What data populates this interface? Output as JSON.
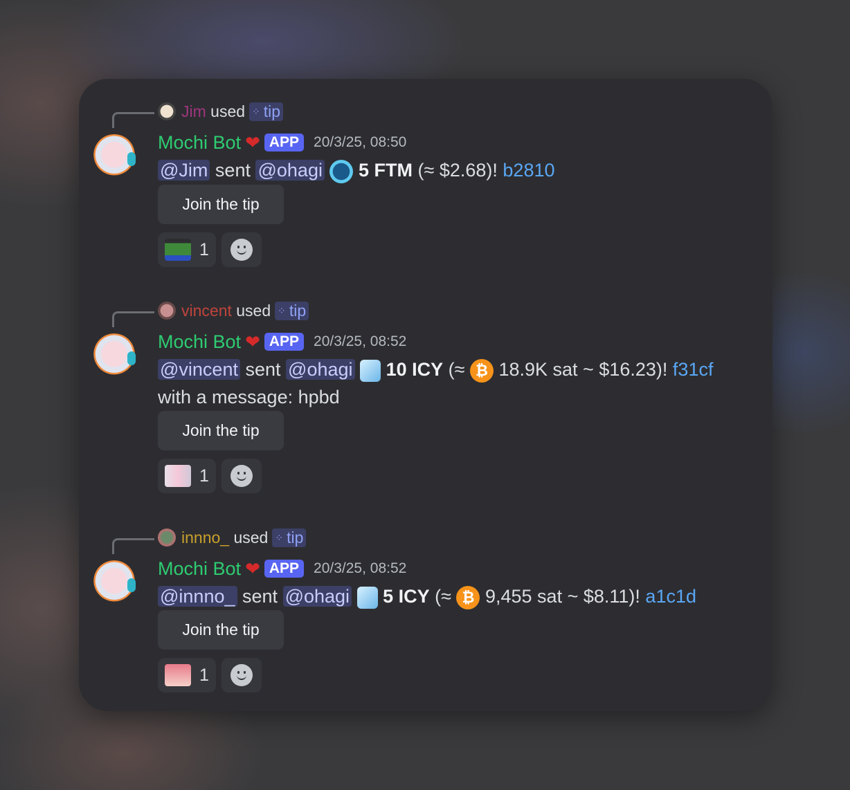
{
  "messages": [
    {
      "user": "Jim",
      "user_color": "#a0357e",
      "used": "used",
      "command": "tip",
      "bot": "Mochi Bot",
      "badge": "APP",
      "time": "20/3/25, 08:50",
      "from": "@Jim",
      "sent": "sent",
      "to": "@ohagi",
      "token_icon": "fantom-coin-icon",
      "amount": "5 FTM",
      "value": "(≈ $2.68)!",
      "tx": "b2810",
      "line2": "",
      "button": "Join the tip",
      "reaction_emoji": "pepe-pray-emoji",
      "reaction_count": "1"
    },
    {
      "user": "vincent",
      "user_color": "#c0443c",
      "used": "used",
      "command": "tip",
      "bot": "Mochi Bot",
      "badge": "APP",
      "time": "20/3/25, 08:52",
      "from": "@vincent",
      "sent": "sent",
      "to": "@ohagi",
      "token_icon": "ice-cube-icon",
      "amount": "10 ICY",
      "value_pre": "(≈",
      "btc": "₿",
      "value": "18.9K sat ~ $16.23)!",
      "tx": "f31cf",
      "line2": "with a message: hpbd",
      "button": "Join the tip",
      "reaction_emoji": "anime-girl-emoji",
      "reaction_count": "1"
    },
    {
      "user": "innno_",
      "user_color": "#c9a02c",
      "used": "used",
      "command": "tip",
      "bot": "Mochi Bot",
      "badge": "APP",
      "time": "20/3/25, 08:52",
      "from": "@innno_",
      "sent": "sent",
      "to": "@ohagi",
      "token_icon": "ice-cube-icon",
      "amount": "5 ICY",
      "value_pre": "(≈",
      "btc": "₿",
      "value": "9,455 sat ~ $8.11)!",
      "tx": "a1c1d",
      "line2": "",
      "button": "Join the tip",
      "reaction_emoji": "pink-hair-girl-emoji",
      "reaction_count": "1"
    }
  ],
  "colors": {
    "bot_name": "#2ecc71",
    "badge": "#5865f2",
    "link": "#5aa7f5",
    "card": "#2d2d31"
  }
}
